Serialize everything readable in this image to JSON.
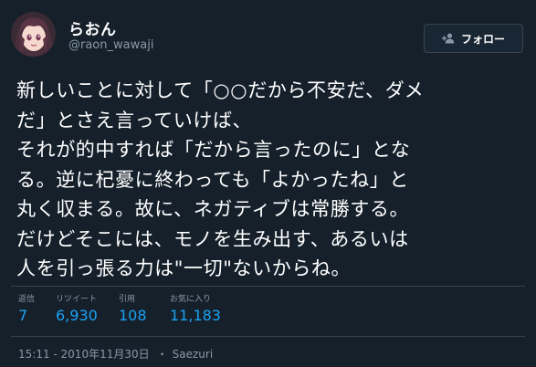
{
  "tweet": {
    "author": {
      "display_name": "らおん",
      "handle": "@raon_wawaji",
      "avatar_icon": "avatar-anime-girl"
    },
    "follow_button": {
      "label": "フォロー",
      "icon": "add-user-icon"
    },
    "text": "新しいことに対して「○○だから不安だ、ダメ\nだ」とさえ言っていけば、\nそれが的中すれば「だから言ったのに」とな\nる。逆に杞憂に終わっても「よかったね」と\n丸く収まる。故に、ネガティブは常勝する。\nだけどそこには、モノを生み出す、あるいは\n人を引っ張る力は\"一切\"ないからね。",
    "stats": [
      {
        "label": "返信",
        "value": "7"
      },
      {
        "label": "リツイート",
        "value": "6,930"
      },
      {
        "label": "引用",
        "value": "108"
      },
      {
        "label": "お気に入り",
        "value": "11,183"
      }
    ],
    "timestamp": "15:11 - 2010年11月30日",
    "separator": "・",
    "source": "Saezuri"
  },
  "colors": {
    "background": "#15202b",
    "text": "#ffffff",
    "muted": "#8899a6",
    "accent": "#1da1f2",
    "border": "#38444d"
  }
}
